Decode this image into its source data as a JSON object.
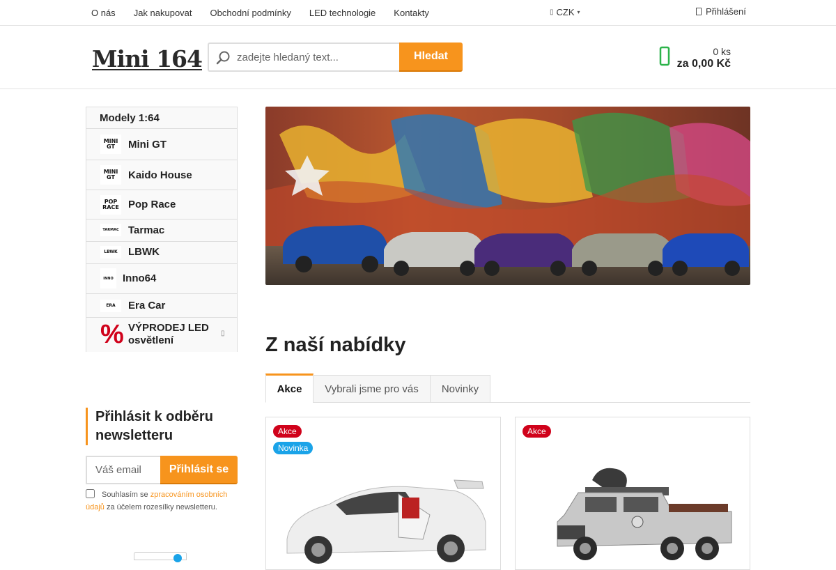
{
  "topnav": {
    "items": [
      "O nás",
      "Jak nakupovat",
      "Obchodní podmínky",
      "LED technologie",
      "Kontakty"
    ],
    "currency": "CZK",
    "login": "Přihlášení"
  },
  "header": {
    "logo": "Mini 164",
    "search_placeholder": "zadejte hledaný text...",
    "search_button": "Hledat",
    "cart_qty": "0 ks",
    "cart_price": "za 0,00 Kč"
  },
  "sidebar": {
    "title": "Modely 1:64",
    "items": [
      {
        "label": "Mini GT",
        "logo_text": "MINI GT"
      },
      {
        "label": "Kaido House",
        "logo_text": "MINI GT"
      },
      {
        "label": "Pop Race",
        "logo_text": "POP RACE"
      },
      {
        "label": "Tarmac",
        "logo_text": "TARMAC"
      },
      {
        "label": "LBWK",
        "logo_text": "LBWK"
      },
      {
        "label": "Inno64",
        "logo_text": "INNO"
      },
      {
        "label": "Era Car",
        "logo_text": "ERA"
      },
      {
        "label": "VÝPRODEJ LED osvětlení",
        "logo_text": "%"
      }
    ]
  },
  "newsletter": {
    "title": "Přihlásit k odběru newsletteru",
    "email_placeholder": "Váš email",
    "button": "Přihlásit se",
    "consent_prefix": "Souhlasím se ",
    "consent_link": "zpracováním osobních údajů",
    "consent_suffix": " za účelem rozesílky newsletteru."
  },
  "main": {
    "heading": "Z naší nabídky",
    "tabs": [
      "Akce",
      "Vybrali jsme pro vás",
      "Novinky"
    ],
    "products": [
      {
        "badges": [
          "Akce",
          "Novinka"
        ]
      },
      {
        "badges": [
          "Akce"
        ]
      }
    ]
  },
  "colors": {
    "accent": "#f7941d",
    "sale": "#d0021b",
    "new": "#1aa3e8",
    "cart_icon": "#2db34a"
  }
}
